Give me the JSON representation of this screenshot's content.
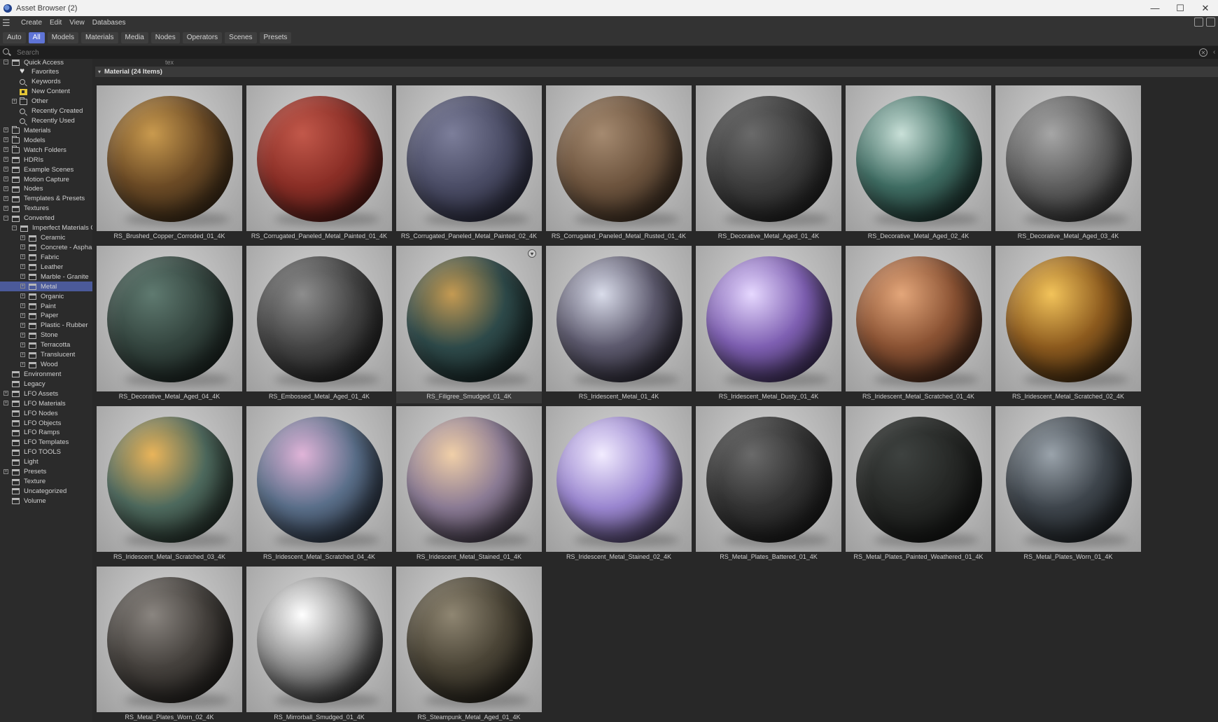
{
  "window": {
    "title": "Asset Browser (2)"
  },
  "menu": [
    "Create",
    "Edit",
    "View",
    "Databases"
  ],
  "filters": [
    "Auto",
    "All",
    "Models",
    "Materials",
    "Media",
    "Nodes",
    "Operators",
    "Scenes",
    "Presets"
  ],
  "filter_active": "All",
  "search": {
    "placeholder": "Search",
    "path_hint": "tex"
  },
  "sidebar": [
    {
      "label": "Quick Access",
      "level": 0,
      "exp": "−",
      "icon": "db-icon"
    },
    {
      "label": "Favorites",
      "level": 2,
      "exp": "",
      "icon": "heart-icon"
    },
    {
      "label": "Keywords",
      "level": 2,
      "exp": "",
      "icon": "search-icon"
    },
    {
      "label": "New Content",
      "level": 2,
      "exp": "",
      "icon": "new-content-icon"
    },
    {
      "label": "Other",
      "level": 2,
      "exp": "+",
      "icon": "folder-icon"
    },
    {
      "label": "Recently Created",
      "level": 2,
      "exp": "",
      "icon": "search-icon"
    },
    {
      "label": "Recently Used",
      "level": 2,
      "exp": "",
      "icon": "search-icon"
    },
    {
      "label": "Materials",
      "level": 0,
      "exp": "+",
      "icon": "folder-icon"
    },
    {
      "label": "Models",
      "level": 0,
      "exp": "+",
      "icon": "folder-icon"
    },
    {
      "label": "Watch Folders",
      "level": 0,
      "exp": "+",
      "icon": "folder-icon"
    },
    {
      "label": "HDRIs",
      "level": 0,
      "exp": "+",
      "icon": "db-icon"
    },
    {
      "label": "Example Scenes",
      "level": 0,
      "exp": "+",
      "icon": "db-icon"
    },
    {
      "label": "Motion Capture",
      "level": 0,
      "exp": "+",
      "icon": "db-icon"
    },
    {
      "label": "Nodes",
      "level": 0,
      "exp": "+",
      "icon": "db-icon"
    },
    {
      "label": "Templates & Presets",
      "level": 0,
      "exp": "+",
      "icon": "db-icon"
    },
    {
      "label": "Textures",
      "level": 0,
      "exp": "+",
      "icon": "db-icon"
    },
    {
      "label": "Converted",
      "level": 0,
      "exp": "−",
      "icon": "db-icon"
    },
    {
      "label": "Imperfect Materials C",
      "level": 1,
      "exp": "−",
      "icon": "db-icon"
    },
    {
      "label": "Ceramic",
      "level": 2,
      "exp": "+",
      "icon": "db-icon"
    },
    {
      "label": "Concrete - Asphal",
      "level": 2,
      "exp": "+",
      "icon": "db-icon"
    },
    {
      "label": "Fabric",
      "level": 2,
      "exp": "+",
      "icon": "db-icon"
    },
    {
      "label": "Leather",
      "level": 2,
      "exp": "+",
      "icon": "db-icon"
    },
    {
      "label": "Marble - Granite",
      "level": 2,
      "exp": "+",
      "icon": "db-icon"
    },
    {
      "label": "Metal",
      "level": 2,
      "exp": "+",
      "icon": "db-icon",
      "selected": true
    },
    {
      "label": "Organic",
      "level": 2,
      "exp": "+",
      "icon": "db-icon"
    },
    {
      "label": "Paint",
      "level": 2,
      "exp": "+",
      "icon": "db-icon"
    },
    {
      "label": "Paper",
      "level": 2,
      "exp": "+",
      "icon": "db-icon"
    },
    {
      "label": "Plastic - Rubber",
      "level": 2,
      "exp": "+",
      "icon": "db-icon"
    },
    {
      "label": "Stone",
      "level": 2,
      "exp": "+",
      "icon": "db-icon"
    },
    {
      "label": "Terracotta",
      "level": 2,
      "exp": "+",
      "icon": "db-icon"
    },
    {
      "label": "Translucent",
      "level": 2,
      "exp": "+",
      "icon": "db-icon"
    },
    {
      "label": "Wood",
      "level": 2,
      "exp": "+",
      "icon": "db-icon"
    },
    {
      "label": "Environment",
      "level": 0,
      "exp": "",
      "icon": "db-icon"
    },
    {
      "label": "Legacy",
      "level": 0,
      "exp": "",
      "icon": "db-icon"
    },
    {
      "label": "LFO Assets",
      "level": 0,
      "exp": "+",
      "icon": "db-icon"
    },
    {
      "label": "LFO Materials",
      "level": 0,
      "exp": "+",
      "icon": "db-icon"
    },
    {
      "label": "LFO Nodes",
      "level": 0,
      "exp": "",
      "icon": "db-icon"
    },
    {
      "label": "LFO Objects",
      "level": 0,
      "exp": "",
      "icon": "db-icon"
    },
    {
      "label": "LFO Ramps",
      "level": 0,
      "exp": "",
      "icon": "db-icon"
    },
    {
      "label": "LFO Templates",
      "level": 0,
      "exp": "",
      "icon": "db-icon"
    },
    {
      "label": "LFO TOOLS",
      "level": 0,
      "exp": "",
      "icon": "db-icon"
    },
    {
      "label": "Light",
      "level": 0,
      "exp": "",
      "icon": "db-icon"
    },
    {
      "label": "Presets",
      "level": 0,
      "exp": "+",
      "icon": "db-icon"
    },
    {
      "label": "Texture",
      "level": 0,
      "exp": "",
      "icon": "db-icon"
    },
    {
      "label": "Uncategorized",
      "level": 0,
      "exp": "",
      "icon": "db-icon"
    },
    {
      "label": "Volume",
      "level": 0,
      "exp": "",
      "icon": "db-icon"
    }
  ],
  "section": {
    "title": "Material (24 Items)"
  },
  "assets": [
    {
      "name": "RS_Brushed_Copper_Corroded_01_4K",
      "colors": [
        "#c99a4e",
        "#6b4a25",
        "#2a2014"
      ]
    },
    {
      "name": "RS_Corrugated_Paneled_Metal_Painted_01_4K",
      "colors": [
        "#c2584a",
        "#8a2e26",
        "#3b1411"
      ]
    },
    {
      "name": "RS_Corrugated_Paneled_Metal_Painted_02_4K",
      "colors": [
        "#7c7e9a",
        "#4b4d66",
        "#1f2030"
      ]
    },
    {
      "name": "RS_Corrugated_Paneled_Metal_Rusted_01_4K",
      "colors": [
        "#a58a70",
        "#6d543e",
        "#2e2218"
      ]
    },
    {
      "name": "RS_Decorative_Metal_Aged_01_4K",
      "colors": [
        "#6a6a6a",
        "#3c3c3c",
        "#151515"
      ]
    },
    {
      "name": "RS_Decorative_Metal_Aged_02_4K",
      "colors": [
        "#c9e0d8",
        "#3f6d63",
        "#0f1c1a"
      ]
    },
    {
      "name": "RS_Decorative_Metal_Aged_03_4K",
      "colors": [
        "#a6a6a6",
        "#5e5e5e",
        "#202020"
      ]
    },
    {
      "name": "RS_Decorative_Metal_Aged_04_4K",
      "colors": [
        "#5f7a70",
        "#34453f",
        "#131917"
      ]
    },
    {
      "name": "RS_Embossed_Metal_Aged_01_4K",
      "colors": [
        "#8d8d8d",
        "#454545",
        "#141414"
      ]
    },
    {
      "name": "RS_Filigree_Smudged_01_4K",
      "colors": [
        "#c49a52",
        "#2e4a4a",
        "#101818"
      ],
      "selected": true
    },
    {
      "name": "RS_Iridescent_Metal_01_4K",
      "colors": [
        "#d9dcea",
        "#5d5a6e",
        "#17151d"
      ]
    },
    {
      "name": "RS_Iridescent_Metal_Dusty_01_4K",
      "colors": [
        "#e6d8ff",
        "#7e5fb2",
        "#221a33"
      ]
    },
    {
      "name": "RS_Iridescent_Metal_Scratched_01_4K",
      "colors": [
        "#e3a67a",
        "#8a5233",
        "#2b1710"
      ]
    },
    {
      "name": "RS_Iridescent_Metal_Scratched_02_4K",
      "colors": [
        "#f2c35a",
        "#8c5a1e",
        "#22160a"
      ]
    },
    {
      "name": "RS_Iridescent_Metal_Scratched_03_4K",
      "colors": [
        "#e9b45a",
        "#4e6a5e",
        "#151a16"
      ]
    },
    {
      "name": "RS_Iridescent_Metal_Scratched_04_4K",
      "colors": [
        "#e0b4d8",
        "#5a6f8a",
        "#161a22"
      ]
    },
    {
      "name": "RS_Iridescent_Metal_Stained_01_4K",
      "colors": [
        "#f0cfa8",
        "#8a7a94",
        "#201c24"
      ]
    },
    {
      "name": "RS_Iridescent_Metal_Stained_02_4K",
      "colors": [
        "#f2ecff",
        "#9a86d0",
        "#2a2236"
      ]
    },
    {
      "name": "RS_Metal_Plates_Battered_01_4K",
      "colors": [
        "#6a6a6a",
        "#333333",
        "#101010"
      ]
    },
    {
      "name": "RS_Metal_Plates_Painted_Weathered_01_4K",
      "colors": [
        "#3e4240",
        "#262826",
        "#0e0f0e"
      ]
    },
    {
      "name": "RS_Metal_Plates_Worn_01_4K",
      "colors": [
        "#9aa3ab",
        "#3e454c",
        "#111416"
      ]
    },
    {
      "name": "RS_Metal_Plates_Worn_02_4K",
      "colors": [
        "#8a8580",
        "#45413d",
        "#161412"
      ]
    },
    {
      "name": "RS_Mirrorball_Smudged_01_4K",
      "colors": [
        "#ffffff",
        "#8c8c8c",
        "#0a0a0a"
      ]
    },
    {
      "name": "RS_Steampunk_Metal_Aged_01_4K",
      "colors": [
        "#8f8672",
        "#4a4436",
        "#161410"
      ]
    }
  ]
}
